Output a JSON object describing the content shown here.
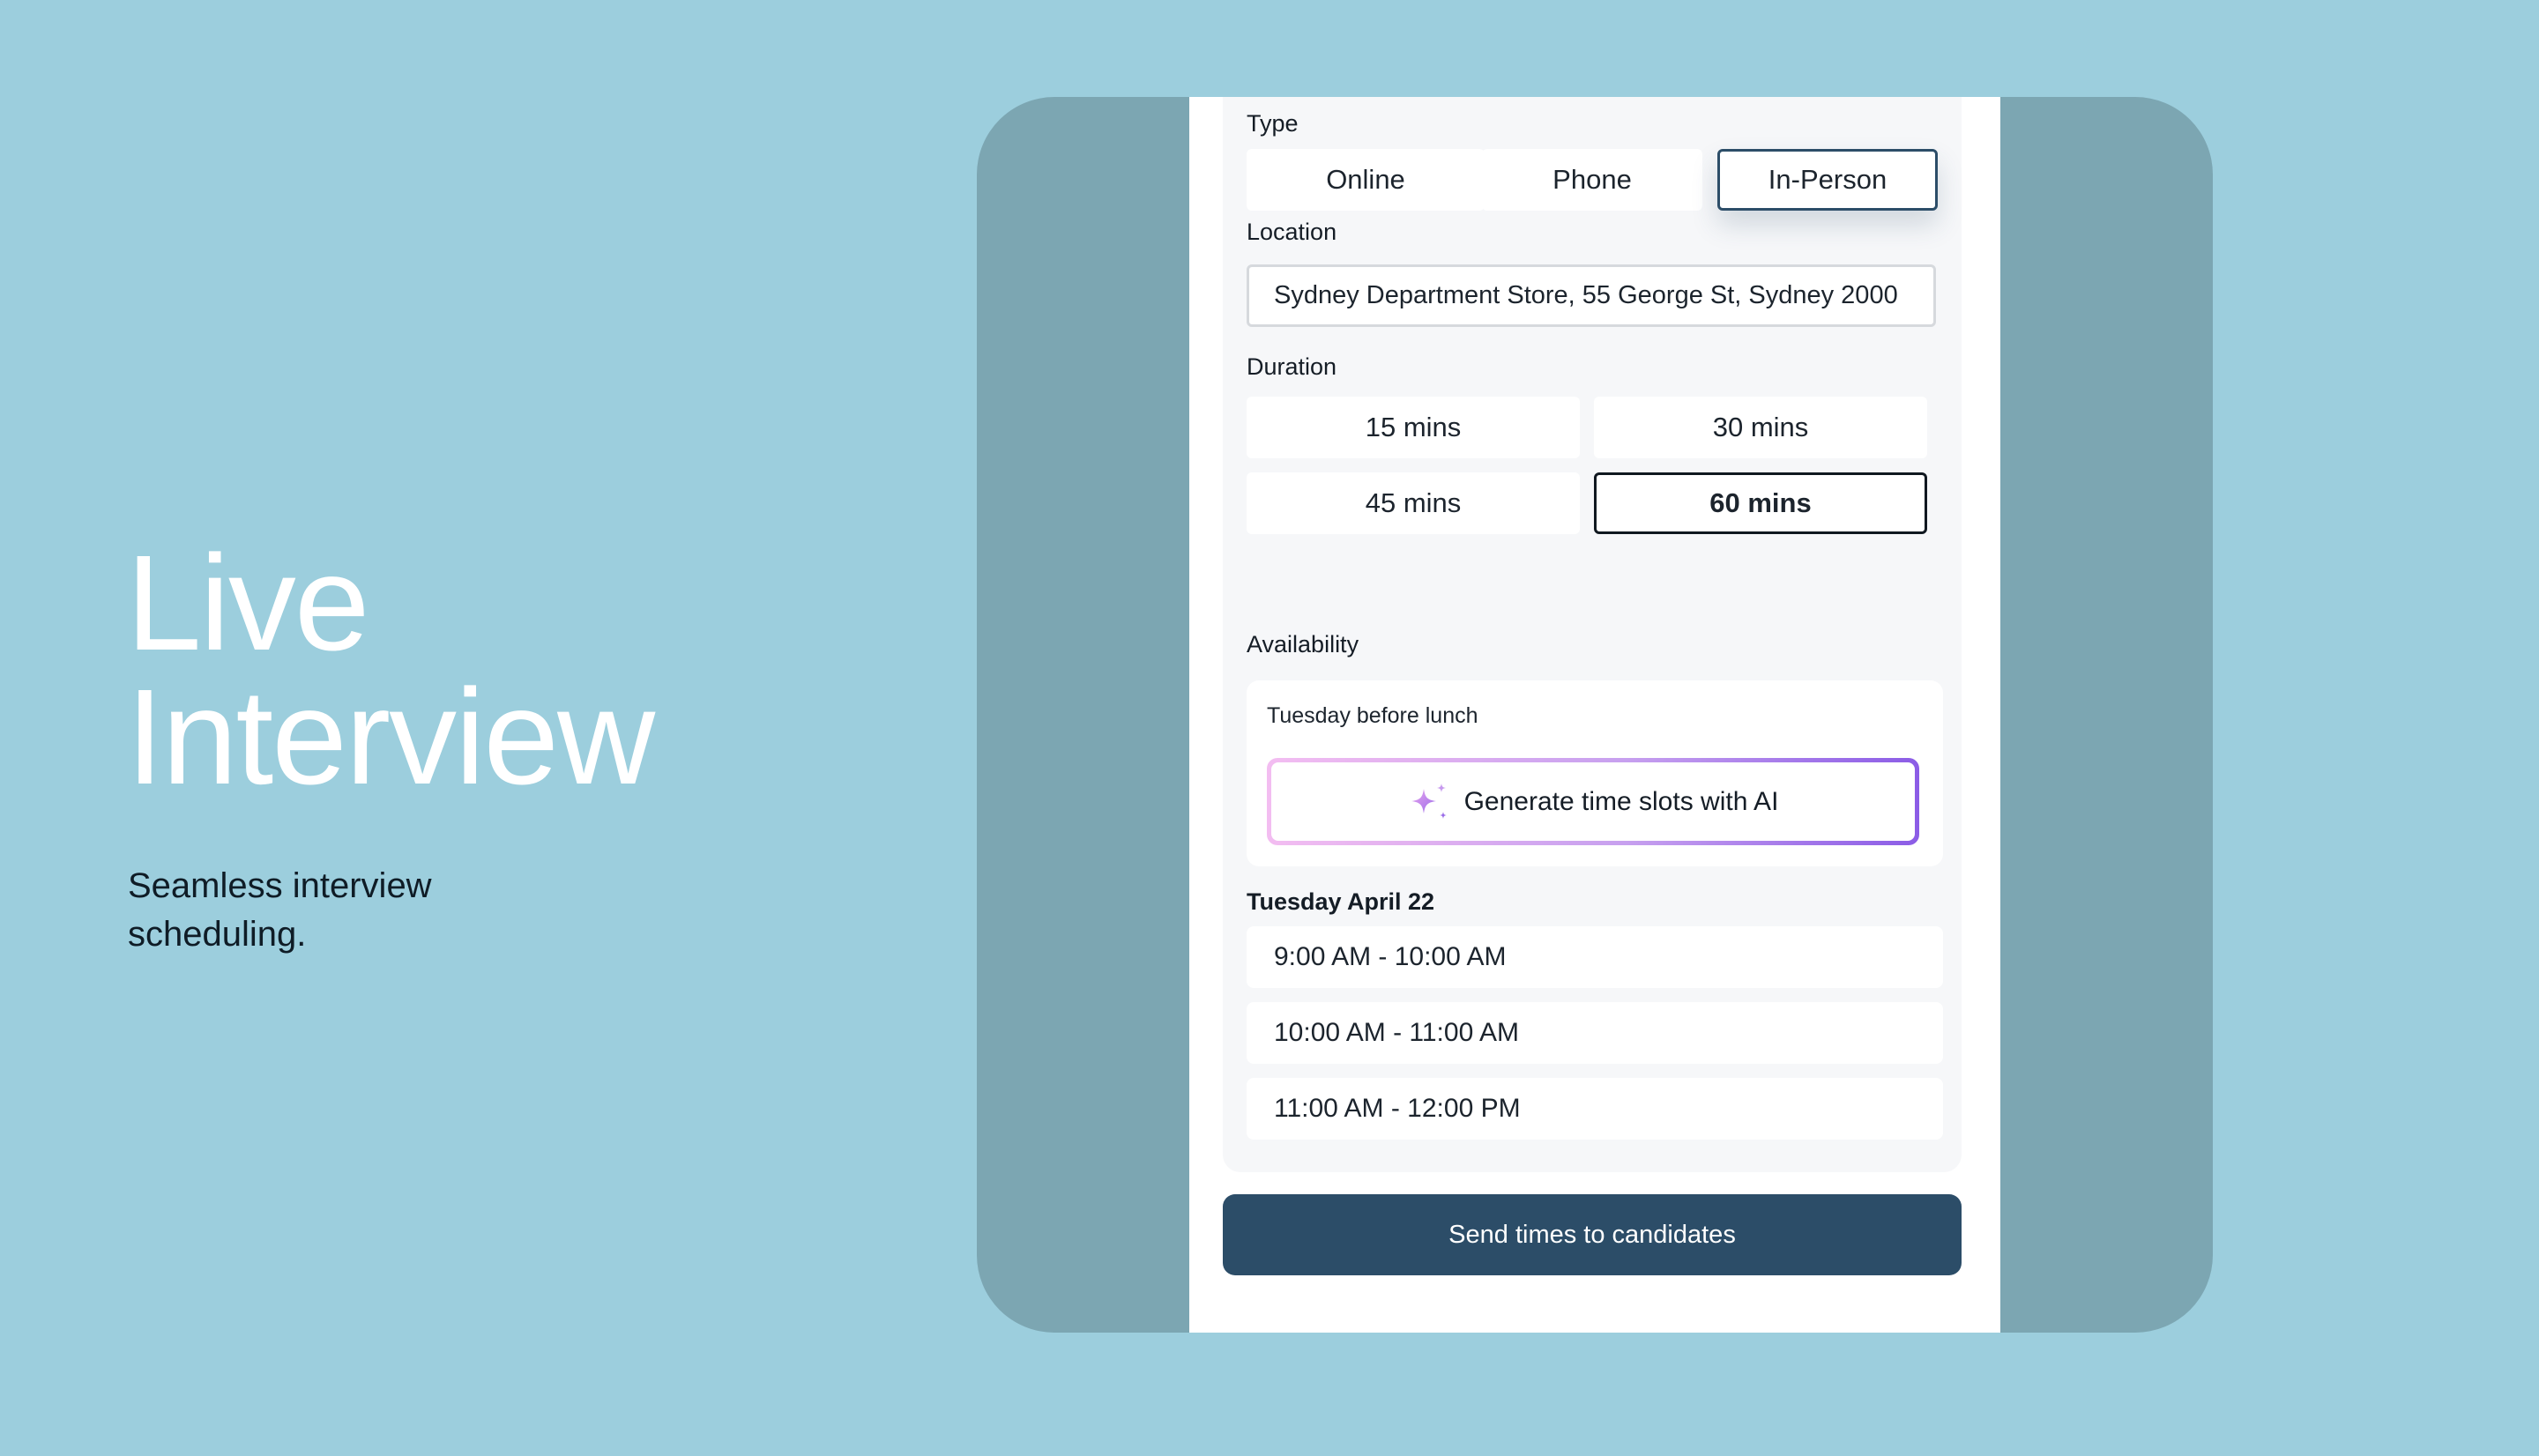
{
  "hero": {
    "title_line1": "Live",
    "title_line2": "Interview",
    "subtitle": "Seamless interview scheduling."
  },
  "form": {
    "type": {
      "label": "Type",
      "options": [
        "Online",
        "Phone",
        "In-Person"
      ],
      "selected": "In-Person"
    },
    "location": {
      "label": "Location",
      "value": "Sydney Department Store, 55 George St, Sydney 2000"
    },
    "duration": {
      "label": "Duration",
      "options": [
        "15 mins",
        "30 mins",
        "45 mins",
        "60 mins"
      ],
      "selected": "60 mins"
    },
    "availability": {
      "label": "Availability",
      "prompt": "Tuesday before lunch",
      "ai_button": "Generate time slots with AI",
      "day_heading": "Tuesday April 22",
      "slots": [
        "9:00 AM - 10:00 AM",
        "10:00 AM - 11:00 AM",
        "11:00 AM - 12:00 PM"
      ]
    },
    "submit_label": "Send times to candidates"
  },
  "colors": {
    "background": "#9ccedd",
    "frame": "#7ca6b2",
    "primary": "#2c4d68",
    "ai_gradient_start": "#f3bdf1",
    "ai_gradient_end": "#8b5ce6"
  },
  "icons": {
    "ai_button_icon": "sparkle-icon"
  }
}
